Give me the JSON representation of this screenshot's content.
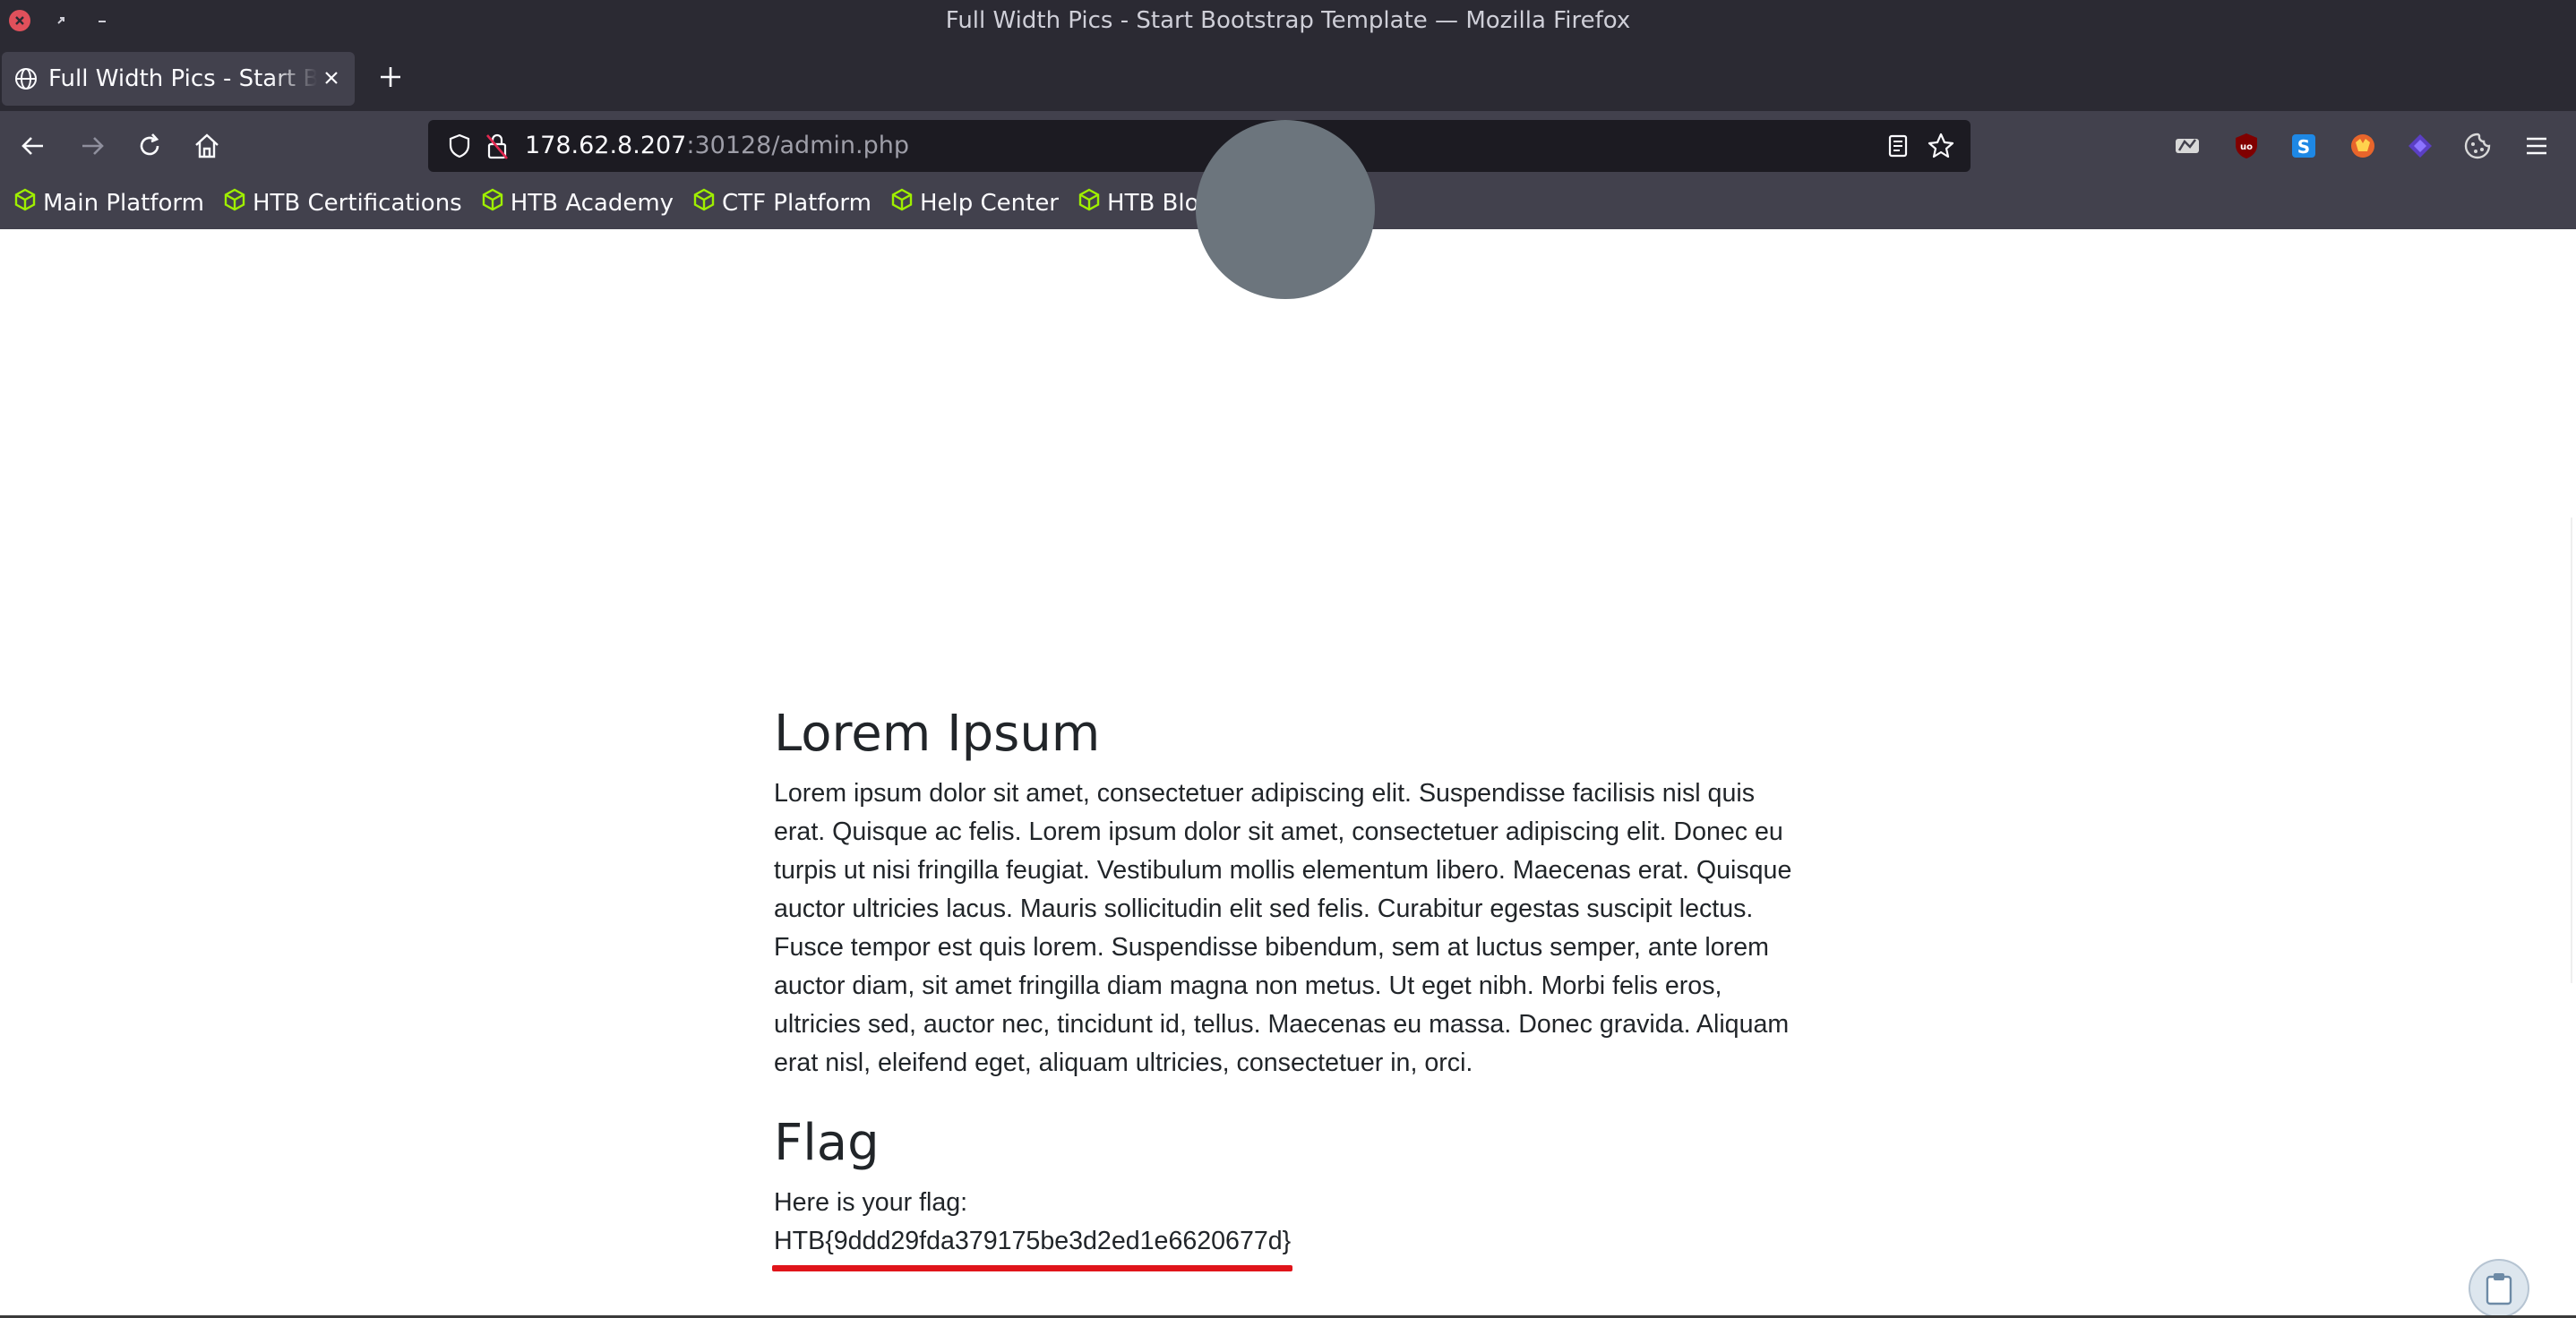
{
  "window": {
    "title": "Full Width Pics - Start Bootstrap Template — Mozilla Firefox"
  },
  "tabs": [
    {
      "label": "Full Width Pics - Start Bootstrap Template",
      "active": true
    }
  ],
  "navbar": {
    "url_host": "178.62.8.207",
    "url_rest": ":30128/admin.php"
  },
  "extensions": [
    {
      "name": "snippet-icon",
      "color": "#d8d8d8"
    },
    {
      "name": "ublock-icon",
      "color": "#800000"
    },
    {
      "name": "s-extension-icon",
      "color": "#1e88e5"
    },
    {
      "name": "foxy-icon",
      "color": "#e8652b"
    },
    {
      "name": "layers-icon",
      "color": "#5b3fc4"
    },
    {
      "name": "cookie-icon",
      "color": "#d8d8d8"
    }
  ],
  "bookmarks": [
    {
      "label": "Main Platform"
    },
    {
      "label": "HTB Certifications"
    },
    {
      "label": "HTB Academy"
    },
    {
      "label": "CTF Platform"
    },
    {
      "label": "Help Center"
    },
    {
      "label": "HTB Blog"
    }
  ],
  "bookmark_icon_color": "#9fef00",
  "content": {
    "heading": "Lorem Ipsum",
    "paragraph": "Lorem ipsum dolor sit amet, consectetuer adipiscing elit. Suspendisse facilisis nisl quis erat. Quisque ac felis. Lorem ipsum dolor sit amet, consectetuer adipiscing elit. Donec eu turpis ut nisi fringilla feugiat. Vestibulum mollis elementum libero. Maecenas erat. Quisque auctor ultricies lacus. Mauris sollicitudin elit sed felis. Curabitur egestas suscipit lectus. Fusce tempor est quis lorem. Suspendisse bibendum, sem at luctus semper, ante lorem auctor diam, sit amet fringilla diam magna non metus. Ut eget nibh. Morbi felis eros, ultricies sed, auctor nec, tincidunt id, tellus. Maecenas eu massa. Donec gravida. Aliquam erat nisl, eleifend eget, aliquam ultricies, consectetuer in, orci.",
    "flag_heading": "Flag",
    "flag_intro": "Here is your flag:",
    "flag_value": "HTB{9ddd29fda379175be3d2ed1e6620677d}"
  },
  "colors": {
    "highlight": "#e0141a"
  }
}
